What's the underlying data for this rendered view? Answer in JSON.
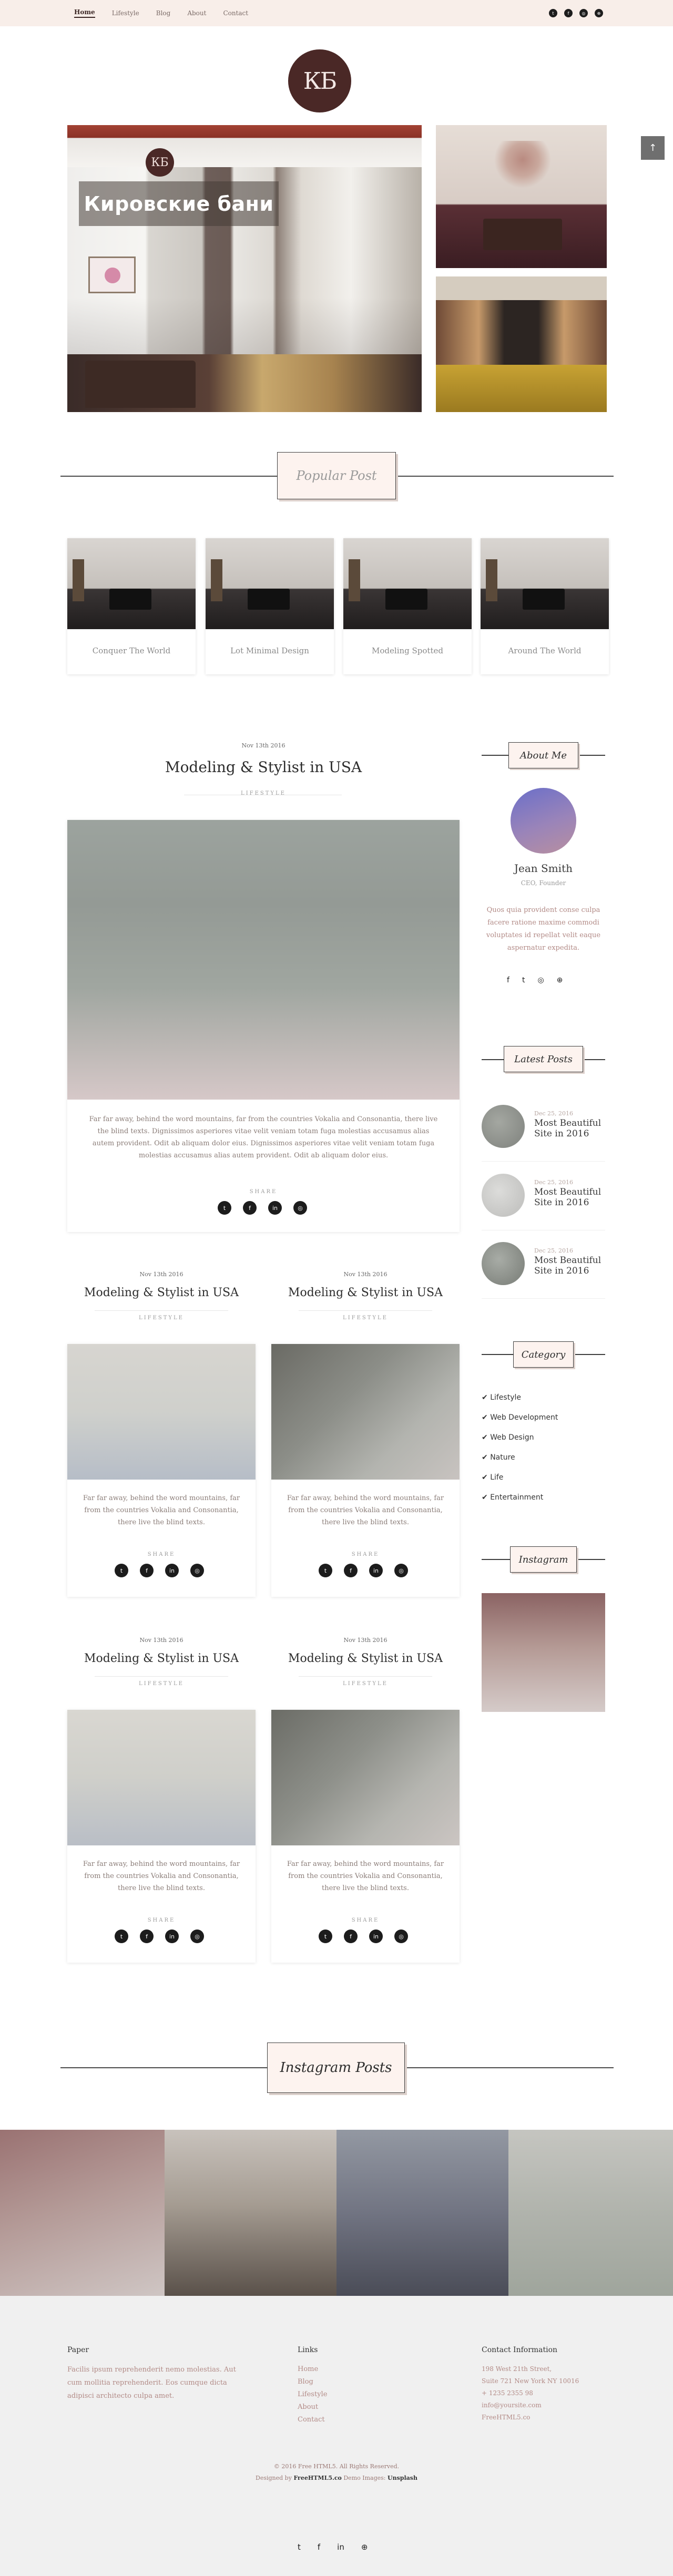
{
  "nav": {
    "items": [
      "Home",
      "Lifestyle",
      "Blog",
      "About",
      "Contact"
    ],
    "social_icons": [
      "twitter-icon",
      "facebook-icon",
      "instagram-icon",
      "dribbble-icon"
    ]
  },
  "logo": {
    "text": "КБ"
  },
  "hero": {
    "badge": "КБ",
    "title": "Кировские бани",
    "scroll_icon": "chevron-down-icon"
  },
  "popular": {
    "heading": "Popular Post",
    "posts": [
      "Conquer The World",
      "Lot Minimal Design",
      "Modeling Spotted",
      "Around The World"
    ]
  },
  "featured_post": {
    "date": "Nov 13th 2016",
    "title": "Modeling & Stylist in USA",
    "category": "LIFESTYLE",
    "excerpt": "Far far away, behind the word mountains, far from the countries Vokalia and Consonantia, there live the blind texts. Dignissimos asperiores vitae velit veniam totam fuga molestias accusamus alias autem provident. Odit ab aliquam dolor eius. Dignissimos asperiores vitae velit veniam totam fuga molestias accusamus alias autem provident. Odit ab aliquam dolor eius.",
    "share_label": "SHARE"
  },
  "grid_posts": [
    {
      "date": "Nov 13th 2016",
      "title": "Modeling & Stylist in USA",
      "category": "LIFESTYLE",
      "excerpt": "Far far away, behind the word mountains, far from the countries Vokalia and Consonantia, there live the blind texts.",
      "share_label": "SHARE"
    },
    {
      "date": "Nov 13th 2016",
      "title": "Modeling & Stylist in USA",
      "category": "LIFESTYLE",
      "excerpt": "Far far away, behind the word mountains, far from the countries Vokalia and Consonantia, there live the blind texts.",
      "share_label": "SHARE"
    },
    {
      "date": "Nov 13th 2016",
      "title": "Modeling & Stylist in USA",
      "category": "LIFESTYLE",
      "excerpt": "Far far away, behind the word mountains, far from the countries Vokalia and Consonantia, there live the blind texts.",
      "share_label": "SHARE"
    },
    {
      "date": "Nov 13th 2016",
      "title": "Modeling & Stylist in USA",
      "category": "LIFESTYLE",
      "excerpt": "Far far away, behind the word mountains, far from the countries Vokalia and Consonantia, there live the blind texts.",
      "share_label": "SHARE"
    }
  ],
  "share_icons": [
    "twitter-icon",
    "facebook-icon",
    "linkedin-icon",
    "instagram-icon"
  ],
  "sidebar": {
    "about": {
      "heading": "About Me",
      "name": "Jean Smith",
      "role": "CEO, Founder",
      "text": "Quos quia provident conse culpa facere ratione maxime commodi voluptates id repellat velit eaque aspernatur expedita.",
      "social_icons": [
        "facebook-icon",
        "twitter-icon",
        "instagram-icon",
        "dribbble-icon"
      ]
    },
    "latest": {
      "heading": "Latest Posts",
      "posts": [
        {
          "date": "Dec 25, 2016",
          "title": "Most Beautiful Site in 2016"
        },
        {
          "date": "Dec 25, 2016",
          "title": "Most Beautiful Site in 2016"
        },
        {
          "date": "Dec 25, 2016",
          "title": "Most Beautiful Site in 2016"
        }
      ]
    },
    "category": {
      "heading": "Category",
      "items": [
        "Lifestyle",
        "Web Development",
        "Web Design",
        "Nature",
        "Life",
        "Entertainment"
      ]
    },
    "instagram": {
      "heading": "Instagram"
    }
  },
  "instagram_section": {
    "heading": "Instagram Posts"
  },
  "footer": {
    "paper": {
      "heading": "Paper",
      "text": "Facilis ipsum reprehenderit nemo molestias. Aut cum mollitia reprehenderit. Eos cumque dicta adipisci architecto culpa amet."
    },
    "links": {
      "heading": "Links",
      "items": [
        "Home",
        "Blog",
        "Lifestyle",
        "About",
        "Contact"
      ]
    },
    "contact": {
      "heading": "Contact Information",
      "lines": [
        "198 West 21th Street,",
        "Suite 721 New York NY 10016",
        "+ 1235 2355 98",
        "info@yoursite.com",
        "FreeHTML5.co"
      ]
    },
    "copyright": "© 2016 Free HTML5. All Rights Reserved.",
    "credit_prefix": "Designed by",
    "credit_brand": "FreeHTML5.co",
    "credit_mid": "Demo Images:",
    "credit_images": "Unsplash",
    "social_icons": [
      "twitter-icon",
      "facebook-icon",
      "linkedin-icon",
      "dribbble-icon"
    ]
  }
}
